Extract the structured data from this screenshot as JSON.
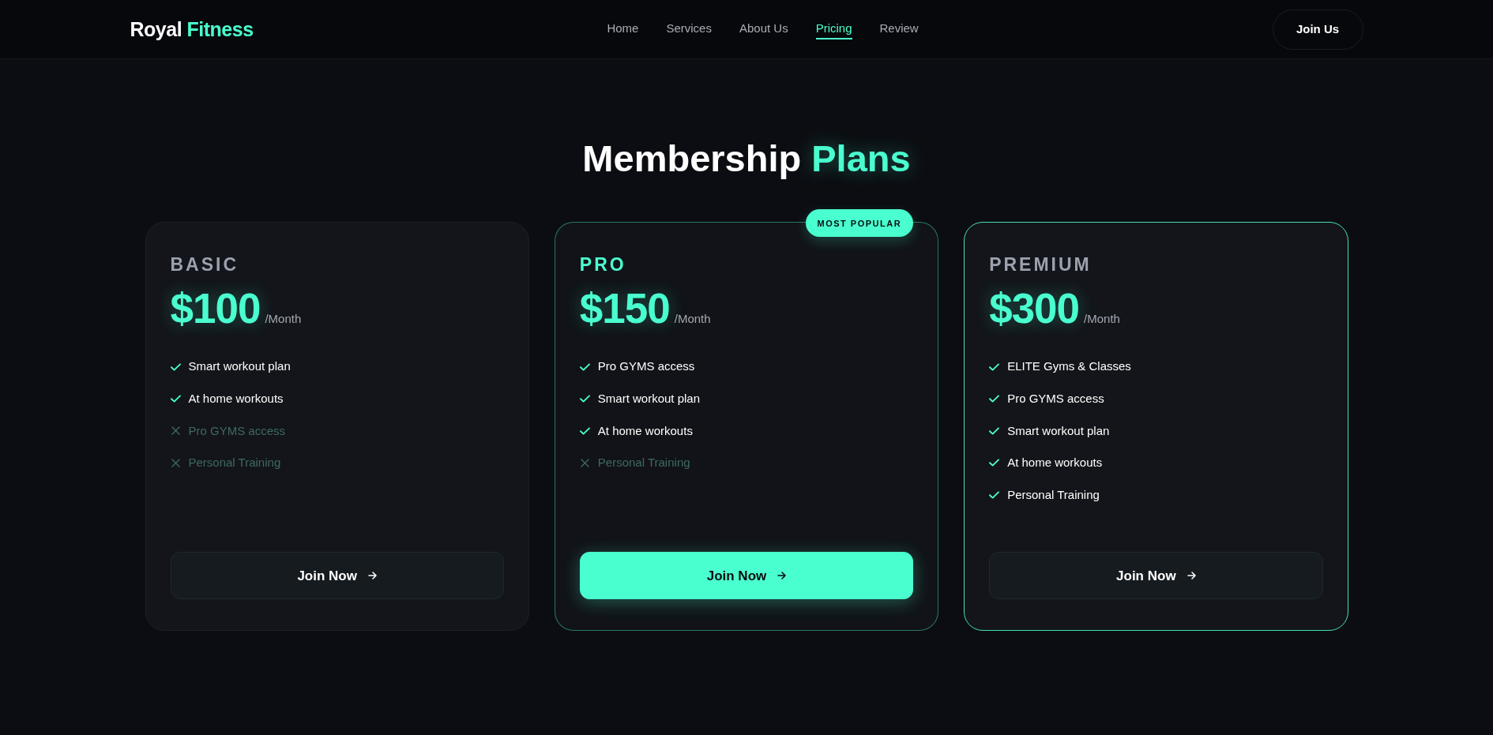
{
  "navbar": {
    "logo": {
      "text": "Royal",
      "accent": "Fitness"
    },
    "links": [
      {
        "label": "Home",
        "selected": false
      },
      {
        "label": "Services",
        "selected": false
      },
      {
        "label": "About Us",
        "selected": false
      },
      {
        "label": "Pricing",
        "selected": true
      },
      {
        "label": "Review",
        "selected": false
      }
    ],
    "cta": "Join Us"
  },
  "heading": {
    "text": "Membership",
    "accent": "Plans"
  },
  "plans": [
    {
      "name": "BASIC",
      "price": "$100",
      "period": "/Month",
      "featured": false,
      "hovered": false,
      "features": [
        {
          "label": "Smart workout plan",
          "included": true
        },
        {
          "label": "At home workouts",
          "included": true
        },
        {
          "label": "Pro GYMS access",
          "included": false
        },
        {
          "label": "Personal Training",
          "included": false
        }
      ],
      "button": "Join Now"
    },
    {
      "name": "PRO",
      "badge": "MOST POPULAR",
      "price": "$150",
      "period": "/Month",
      "featured": true,
      "hovered": false,
      "features": [
        {
          "label": "Pro GYMS access",
          "included": true
        },
        {
          "label": "Smart workout plan",
          "included": true
        },
        {
          "label": "At home workouts",
          "included": true
        },
        {
          "label": "Personal Training",
          "included": false
        }
      ],
      "button": "Join Now"
    },
    {
      "name": "PREMIUM",
      "price": "$300",
      "period": "/Month",
      "featured": false,
      "hovered": true,
      "features": [
        {
          "label": "ELITE Gyms & Classes",
          "included": true
        },
        {
          "label": "Pro GYMS access",
          "included": true
        },
        {
          "label": "Smart workout plan",
          "included": true
        },
        {
          "label": "At home workouts",
          "included": true
        },
        {
          "label": "Personal Training",
          "included": true
        }
      ],
      "button": "Join Now"
    }
  ]
}
